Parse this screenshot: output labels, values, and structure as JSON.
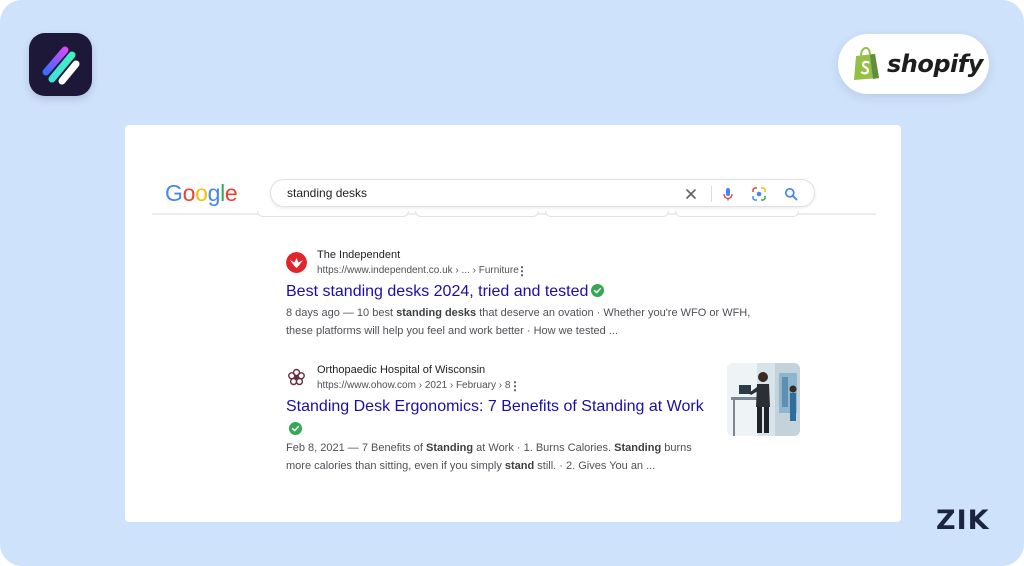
{
  "branding": {
    "shopify_label": "shopify",
    "zik_label": "ZIK",
    "brand_colors": {
      "background": "#cfe2fb",
      "app_tile": "#1d1838",
      "shopify_green": "#95bf47"
    }
  },
  "google": {
    "logo_letters": [
      {
        "ch": "G",
        "color": "#4285f4"
      },
      {
        "ch": "o",
        "color": "#ea4335"
      },
      {
        "ch": "o",
        "color": "#fbbc05"
      },
      {
        "ch": "g",
        "color": "#4285f4"
      },
      {
        "ch": "l",
        "color": "#34a853"
      },
      {
        "ch": "e",
        "color": "#ea4335"
      }
    ],
    "search_query": "standing desks",
    "icons": [
      "close-icon",
      "microphone-icon",
      "lens-icon",
      "search-icon"
    ]
  },
  "results": [
    {
      "site_name": "The Independent",
      "url": "https://www.independent.co.uk › ... › Furniture",
      "title": "Best standing desks 2024, tried and tested",
      "snippet_lines": [
        [
          {
            "t": "8 days ago — 10 best "
          },
          {
            "t": "standing desks",
            "b": true
          },
          {
            "t": " that deserve an ovation · Whether you're WFO or WFH,"
          }
        ],
        [
          {
            "t": "these platforms will help you feel and work better · How we tested ..."
          }
        ]
      ],
      "favicon": "eagle-icon"
    },
    {
      "site_name": "Orthopaedic Hospital of Wisconsin",
      "url": "https://www.ohow.com › 2021 › February › 8",
      "title": "Standing Desk Ergonomics: 7 Benefits of Standing at Work",
      "snippet_lines": [
        [
          {
            "t": "Feb 8, 2021 — 7 Benefits of "
          },
          {
            "t": "Standing",
            "b": true
          },
          {
            "t": " at Work · 1. Burns Calories. "
          },
          {
            "t": "Standing",
            "b": true
          },
          {
            "t": " burns"
          }
        ],
        [
          {
            "t": "more calories than sitting, even if you simply "
          },
          {
            "t": "stand",
            "b": true
          },
          {
            "t": " still. · 2. Gives You an ..."
          }
        ]
      ],
      "favicon": "flower-icon",
      "thumbnail": "person-at-standing-desk-image"
    }
  ],
  "accent_colors": {
    "link": "#1a0dab",
    "verified": "#34a853"
  }
}
